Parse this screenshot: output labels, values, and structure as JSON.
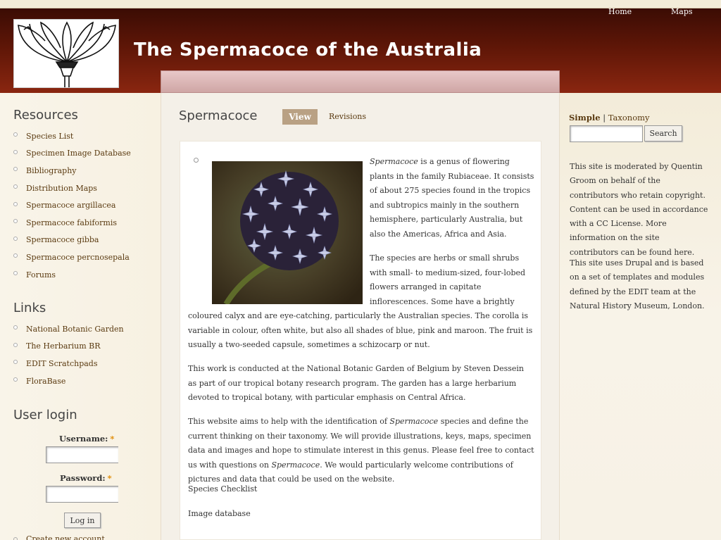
{
  "site": {
    "title": "The Spermacoce of the Australia"
  },
  "topnav": [
    {
      "label": "Home"
    },
    {
      "label": "Maps"
    }
  ],
  "resources": {
    "title": "Resources",
    "items": [
      {
        "label": "Species List"
      },
      {
        "label": "Specimen Image Database"
      },
      {
        "label": "Bibliography"
      },
      {
        "label": "Distribution Maps"
      },
      {
        "label": "Spermacoce argillacea"
      },
      {
        "label": "Spermacoce fabiformis"
      },
      {
        "label": "Spermacoce gibba"
      },
      {
        "label": "Spermacoce percnosepala"
      },
      {
        "label": "Forums"
      }
    ]
  },
  "links": {
    "title": "Links",
    "items": [
      {
        "label": "National Botanic Garden"
      },
      {
        "label": "The Herbarium BR"
      },
      {
        "label": "EDIT Scratchpads"
      },
      {
        "label": "FloraBase"
      }
    ]
  },
  "login": {
    "title": "User login",
    "username_label": "Username:",
    "password_label": "Password:",
    "required_mark": "*",
    "button": "Log in",
    "create_account": "Create new account"
  },
  "page": {
    "title": "Spermacoce",
    "tab_view": "View",
    "tab_revisions": "Revisions",
    "intro_italic": "Spermacoce",
    "intro_rest": "is a genus of flowering plants in the family Rubiaceae. It consists of about 275 species found in the tropics and subtropics mainly in the southern hemisphere, particularly Australia, but also the Americas, Africa and Asia.",
    "para2": "The species are herbs or small shrubs with small- to medium-sized, four-lobed flowers arranged in capitate inflorescences. Some have a brightly coloured calyx and are eye-catching, particularly the Australian species. The corolla is variable in colour, often white, but also all shades of blue, pink and maroon. The fruit is usually a two-seeded capsule, sometimes a schizocarp or nut.",
    "para3": "This work is conducted at the National Botanic Garden of Belgium by Steven Dessein as part of our tropical botany research program. The garden has a large herbarium devoted to tropical botany, with particular emphasis on Central Africa.",
    "para4_a": "This website aims to help with the identification of",
    "para4_i1": "Spermacoce",
    "para4_b": "species and define the current thinking on their taxonomy. We will provide illustrations, keys, maps, specimen data and images and hope to stimulate interest in this genus. Please feel free to contact us with questions on",
    "para4_i2": "Spermacoce",
    "para4_c": ". We would particularly welcome contributions of pictures and data that could be used on the website.",
    "link_checklist": "Species Checklist",
    "link_image_db": "Image database"
  },
  "search": {
    "tab_simple": "Simple",
    "separator": "|",
    "tab_taxonomy": "Taxonomy",
    "button": "Search"
  },
  "right": {
    "moderation": "This site is moderated by Quentin Groom on behalf of the contributors who retain copyright. Content can be used in accordance with a CC License. More information on the site contributors can be found here.",
    "drupal": "This site uses Drupal and is based on a set of templates and modules defined by the EDIT team at the Natural History Museum, London."
  }
}
